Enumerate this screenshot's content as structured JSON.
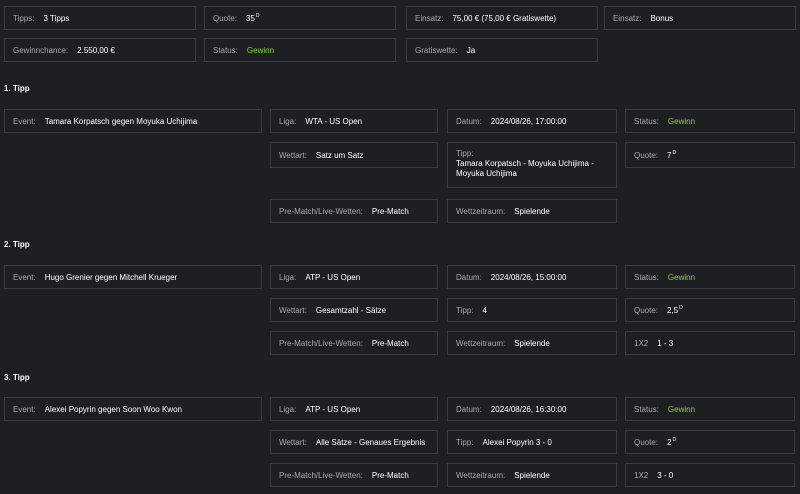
{
  "summary": {
    "tipps": {
      "label": "Tipps:",
      "value": "3 Tipps"
    },
    "quote": {
      "label": "Quote:",
      "value": "35",
      "sup": "D"
    },
    "einsatz": {
      "label": "Einsatz:",
      "value": "75,00 €  (75,00 € Gratiswette)"
    },
    "einsatz_type": {
      "label": "Einsatz:",
      "value": "Bonus"
    },
    "gewinnchance": {
      "label": "Gewinnchance:",
      "value": "2.550,00 €"
    },
    "status": {
      "label": "Status:",
      "value": "Gewinn"
    },
    "gratiswette": {
      "label": "Gratiswette:",
      "value": "Ja"
    }
  },
  "labels": {
    "event": "Event:",
    "liga": "Liga:",
    "datum": "Datum:",
    "status": "Status:",
    "wettart": "Wettart:",
    "tipp": "Tipp:",
    "quote": "Quote:",
    "prematch": "Pre-Match/Live-Wetten:",
    "wettzeitraum": "Wettzeitraum:",
    "onex2": "1X2"
  },
  "tipps": [
    {
      "heading": "1. Tipp",
      "event": "Tamara Korpatsch gegen Moyuka Uchijima",
      "liga": "WTA - US Open",
      "datum": "2024/08/26, 17:00:00",
      "status": "Gewinn",
      "wettart": "Satz um Satz",
      "tipp": "Tamara Korpatsch - Moyuka Uchijima - Moyuka Uchijima",
      "quote": "7",
      "quote_sup": "D",
      "prematch": "Pre-Match",
      "wettzeitraum": "Spielende"
    },
    {
      "heading": "2. Tipp",
      "event": "Hugo Grenier gegen Mitchell Krueger",
      "liga": "ATP - US Open",
      "datum": "2024/08/26, 15:00:00",
      "status": "Gewinn",
      "wettart": "Gesamtzahl - Sätze",
      "tipp": "4",
      "quote": "2,5",
      "quote_sup": "D",
      "prematch": "Pre-Match",
      "wettzeitraum": "Spielende",
      "onex2": "1 - 3"
    },
    {
      "heading": "3. Tipp",
      "event": "Alexei Popyrin gegen Soon Woo Kwon",
      "liga": "ATP - US Open",
      "datum": "2024/08/26, 16:30:00",
      "status": "Gewinn",
      "wettart": "Alle Sätze - Genaues Ergebnis",
      "tipp": "Alexei Popyrin 3 - 0",
      "quote": "2",
      "quote_sup": "D",
      "prematch": "Pre-Match",
      "wettzeitraum": "Spielende",
      "onex2": "3 - 0"
    }
  ]
}
